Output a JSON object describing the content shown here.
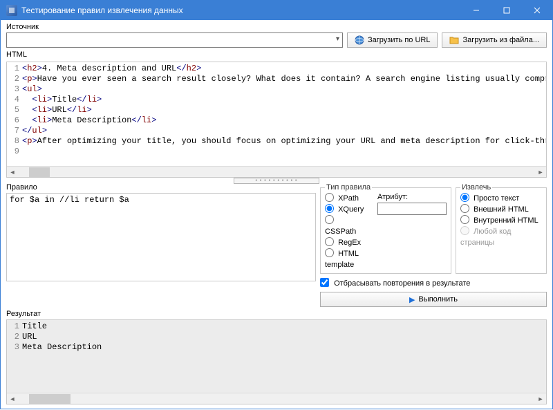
{
  "window": {
    "title": "Тестирование правил извлечения данных"
  },
  "labels": {
    "source": "Источник",
    "html": "HTML",
    "rule": "Правило",
    "ruleType": "Тип правила",
    "attribute": "Атрибут:",
    "extract": "Извлечь",
    "result": "Результат"
  },
  "buttons": {
    "loadUrl": "Загрузить по URL",
    "loadFile": "Загрузить из файла...",
    "execute": "Выполнить"
  },
  "source": {
    "value": ""
  },
  "htmlCode": [
    {
      "n": 1,
      "pre": "",
      "open": "h2",
      "text": "4. Meta description and URL",
      "close": "h2",
      "post": ""
    },
    {
      "n": 2,
      "pre": "",
      "open": "p",
      "text": "Have you ever seen a search result closely? What does it contain? A search engine listing usually comprises",
      "close": "",
      "post": ""
    },
    {
      "n": 3,
      "pre": "",
      "open": "ul",
      "text": "",
      "close": "",
      "post": ""
    },
    {
      "n": 4,
      "pre": "  ",
      "open": "li",
      "text": "Title",
      "close": "li",
      "post": ""
    },
    {
      "n": 5,
      "pre": "  ",
      "open": "li",
      "text": "URL",
      "close": "li",
      "post": ""
    },
    {
      "n": 6,
      "pre": "  ",
      "open": "li",
      "text": "Meta Description",
      "close": "li",
      "post": ""
    },
    {
      "n": 7,
      "pre": "",
      "open": "",
      "text": "",
      "close": "ul",
      "post": ""
    },
    {
      "n": 8,
      "pre": "",
      "open": "p",
      "text": "After optimizing your title, you should focus on optimizing your URL and meta description for click-through",
      "close": "",
      "post": ""
    },
    {
      "n": 9,
      "pre": "",
      "open": "",
      "text": "",
      "close": "",
      "post": ""
    }
  ],
  "ruleText": "for $a in //li return $a",
  "ruleTypes": {
    "xpath": "XPath",
    "xquery": "XQuery",
    "csspath": "CSSPath",
    "regex": "RegEx",
    "htmltpl": "HTML template",
    "selected": "xquery"
  },
  "extractOptions": {
    "plain": "Просто текст",
    "outer": "Внешний HTML",
    "inner": "Внутренний HTML",
    "anycode": "Любой код страницы",
    "selected": "plain"
  },
  "discardRepeats": {
    "label": "Отбрасывать повторения в результате",
    "checked": true
  },
  "attributeValue": "",
  "results": [
    {
      "n": 1,
      "text": "Title"
    },
    {
      "n": 2,
      "text": "URL"
    },
    {
      "n": 3,
      "text": "Meta Description"
    }
  ]
}
